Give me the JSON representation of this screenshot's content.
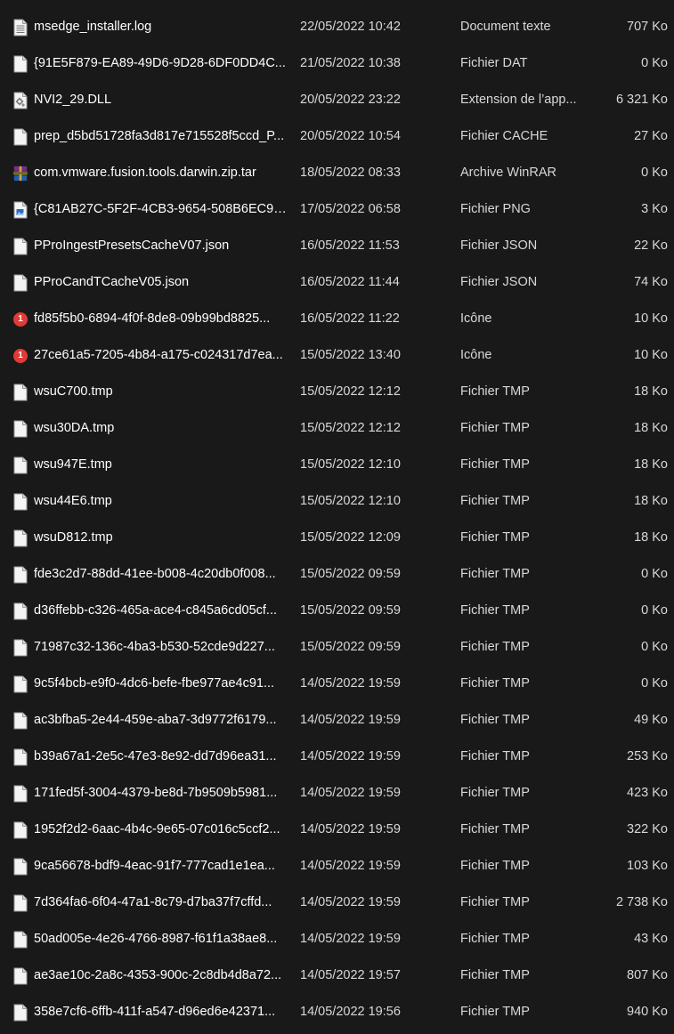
{
  "colors": {
    "background": "#191919",
    "text": "#ffffff",
    "secondary_text": "#d8d8d8",
    "badge_red": "#e23a36"
  },
  "files": [
    {
      "icon": "text-document-icon",
      "name": "msedge_installer.log",
      "date": "22/05/2022 10:42",
      "type": "Document texte",
      "size": "707 Ko"
    },
    {
      "icon": "blank-file-icon",
      "name": "{91E5F879-EA89-49D6-9D28-6DF0DD4C...",
      "date": "21/05/2022 10:38",
      "type": "Fichier DAT",
      "size": "0 Ko"
    },
    {
      "icon": "dll-file-icon",
      "name": "NVI2_29.DLL",
      "date": "20/05/2022 23:22",
      "type": "Extension de l’app...",
      "size": "6 321 Ko"
    },
    {
      "icon": "blank-file-icon",
      "name": "prep_d5bd51728fa3d817e715528f5ccd_P...",
      "date": "20/05/2022 10:54",
      "type": "Fichier CACHE",
      "size": "27 Ko"
    },
    {
      "icon": "winrar-archive-icon",
      "name": "com.vmware.fusion.tools.darwin.zip.tar",
      "date": "18/05/2022 08:33",
      "type": "Archive WinRAR",
      "size": "0 Ko"
    },
    {
      "icon": "image-file-icon",
      "name": "{C81AB27C-5F2F-4CB3-9654-508B6EC98...",
      "date": "17/05/2022 06:58",
      "type": "Fichier PNG",
      "size": "3 Ko"
    },
    {
      "icon": "blank-file-icon",
      "name": "PProIngestPresetsCacheV07.json",
      "date": "16/05/2022 11:53",
      "type": "Fichier JSON",
      "size": "22 Ko"
    },
    {
      "icon": "blank-file-icon",
      "name": "PProCandTCacheV05.json",
      "date": "16/05/2022 11:44",
      "type": "Fichier JSON",
      "size": "74 Ko"
    },
    {
      "icon": "notification-badge-icon",
      "badge": "1",
      "name": "fd85f5b0-6894-4f0f-8de8-09b99bd8825...",
      "date": "16/05/2022 11:22",
      "type": "Icône",
      "size": "10 Ko"
    },
    {
      "icon": "notification-badge-icon",
      "badge": "1",
      "name": "27ce61a5-7205-4b84-a175-c024317d7ea...",
      "date": "15/05/2022 13:40",
      "type": "Icône",
      "size": "10 Ko"
    },
    {
      "icon": "blank-file-icon",
      "name": "wsuC700.tmp",
      "date": "15/05/2022 12:12",
      "type": "Fichier TMP",
      "size": "18 Ko"
    },
    {
      "icon": "blank-file-icon",
      "name": "wsu30DA.tmp",
      "date": "15/05/2022 12:12",
      "type": "Fichier TMP",
      "size": "18 Ko"
    },
    {
      "icon": "blank-file-icon",
      "name": "wsu947E.tmp",
      "date": "15/05/2022 12:10",
      "type": "Fichier TMP",
      "size": "18 Ko"
    },
    {
      "icon": "blank-file-icon",
      "name": "wsu44E6.tmp",
      "date": "15/05/2022 12:10",
      "type": "Fichier TMP",
      "size": "18 Ko"
    },
    {
      "icon": "blank-file-icon",
      "name": "wsuD812.tmp",
      "date": "15/05/2022 12:09",
      "type": "Fichier TMP",
      "size": "18 Ko"
    },
    {
      "icon": "blank-file-icon",
      "name": "fde3c2d7-88dd-41ee-b008-4c20db0f008...",
      "date": "15/05/2022 09:59",
      "type": "Fichier TMP",
      "size": "0 Ko"
    },
    {
      "icon": "blank-file-icon",
      "name": "d36ffebb-c326-465a-ace4-c845a6cd05cf...",
      "date": "15/05/2022 09:59",
      "type": "Fichier TMP",
      "size": "0 Ko"
    },
    {
      "icon": "blank-file-icon",
      "name": "71987c32-136c-4ba3-b530-52cde9d227...",
      "date": "15/05/2022 09:59",
      "type": "Fichier TMP",
      "size": "0 Ko"
    },
    {
      "icon": "blank-file-icon",
      "name": "9c5f4bcb-e9f0-4dc6-befe-fbe977ae4c91...",
      "date": "14/05/2022 19:59",
      "type": "Fichier TMP",
      "size": "0 Ko"
    },
    {
      "icon": "blank-file-icon",
      "name": "ac3bfba5-2e44-459e-aba7-3d9772f6179...",
      "date": "14/05/2022 19:59",
      "type": "Fichier TMP",
      "size": "49 Ko"
    },
    {
      "icon": "blank-file-icon",
      "name": "b39a67a1-2e5c-47e3-8e92-dd7d96ea31...",
      "date": "14/05/2022 19:59",
      "type": "Fichier TMP",
      "size": "253 Ko"
    },
    {
      "icon": "blank-file-icon",
      "name": "171fed5f-3004-4379-be8d-7b9509b5981...",
      "date": "14/05/2022 19:59",
      "type": "Fichier TMP",
      "size": "423 Ko"
    },
    {
      "icon": "blank-file-icon",
      "name": "1952f2d2-6aac-4b4c-9e65-07c016c5ccf2...",
      "date": "14/05/2022 19:59",
      "type": "Fichier TMP",
      "size": "322 Ko"
    },
    {
      "icon": "blank-file-icon",
      "name": "9ca56678-bdf9-4eac-91f7-777cad1e1ea...",
      "date": "14/05/2022 19:59",
      "type": "Fichier TMP",
      "size": "103 Ko"
    },
    {
      "icon": "blank-file-icon",
      "name": "7d364fa6-6f04-47a1-8c79-d7ba37f7cffd...",
      "date": "14/05/2022 19:59",
      "type": "Fichier TMP",
      "size": "2 738 Ko"
    },
    {
      "icon": "blank-file-icon",
      "name": "50ad005e-4e26-4766-8987-f61f1a38ae8...",
      "date": "14/05/2022 19:59",
      "type": "Fichier TMP",
      "size": "43 Ko"
    },
    {
      "icon": "blank-file-icon",
      "name": "ae3ae10c-2a8c-4353-900c-2c8db4d8a72...",
      "date": "14/05/2022 19:57",
      "type": "Fichier TMP",
      "size": "807 Ko"
    },
    {
      "icon": "blank-file-icon",
      "name": "358e7cf6-6ffb-411f-a547-d96ed6e42371...",
      "date": "14/05/2022 19:56",
      "type": "Fichier TMP",
      "size": "940 Ko"
    }
  ]
}
